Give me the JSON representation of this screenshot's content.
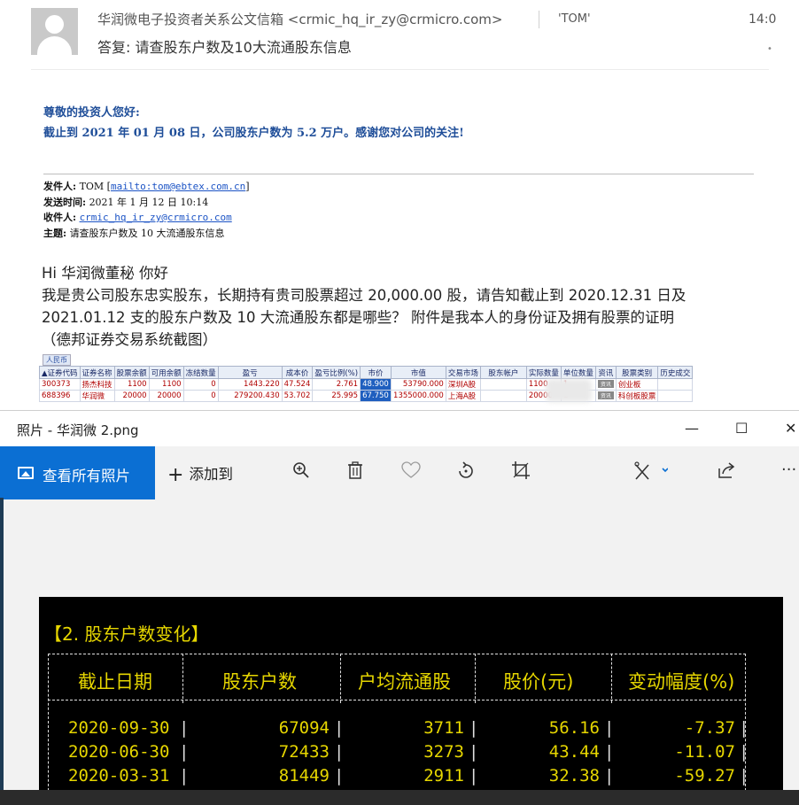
{
  "email": {
    "sender": "华润微电子投资者关系公文信箱 <crmic_hq_ir_zy@crmicro.com>",
    "recipient": "'TOM'",
    "time": "14:0",
    "subject": "答复: 请查股东户数及10大流通股东信息",
    "reply_line1": "尊敬的投资人您好:",
    "reply_line2": "截止到 2021 年 01 月 08 日，公司股东户数为 5.2 万户。感谢您对公司的关注!",
    "quote": {
      "from_label": "发件人:",
      "from_name": "TOM [",
      "from_link": "mailto:tom@ebtex.com.cn",
      "from_end": "]",
      "sent_label": "发送时间:",
      "sent_value": "2021 年 1 月 12 日 10:14",
      "to_label": "收件人:",
      "to_link": "crmic_hq_ir_zy@crmicro.com",
      "subject_label": "主题:",
      "subject_value": "请查股东户数及 10 大流通股东信息"
    },
    "body": {
      "line1": "Hi 华润微董秘 你好",
      "line2": "我是贵公司股东忠实股东，长期持有贵司股票超过 20,000.00 股，请告知截止到 2020.12.31 日及",
      "line3": "2021.01.12 支的股东户数及 10 大流通股东都是哪些？ 附件是我本人的身份证及拥有股票的证明",
      "line4": "（德邦证券交易系统截图）"
    }
  },
  "trade_table": {
    "currency_tab": "人民币",
    "headers": [
      "▲证券代码",
      "证券名称",
      "股票余额",
      "可用余额",
      "冻结数量",
      "盈亏",
      "成本价",
      "盈亏比例(%)",
      "市价",
      "市值",
      "交易市场",
      "股东帐户",
      "实际数量",
      "单位数量",
      "资讯",
      "股票类别",
      "历史成交"
    ],
    "rows": [
      [
        "300373",
        "扬杰科技",
        "1100",
        "1100",
        "0",
        "1443.220",
        "47.524",
        "2.761",
        "48.900",
        "53790.000",
        "深圳A股",
        "",
        "1100",
        "1",
        "资讯",
        "创业板",
        ""
      ],
      [
        "688396",
        "华润微",
        "20000",
        "20000",
        "0",
        "279200.430",
        "53.702",
        "25.995",
        "67.750",
        "1355000.000",
        "上海A股",
        "",
        "20000",
        "1",
        "资讯",
        "科创板股票",
        ""
      ]
    ]
  },
  "photos_app": {
    "window_title": "照片 - 华润微 2.png",
    "minimize": "—",
    "maximize": "☐",
    "close": "✕",
    "view_all": "查看所有照片",
    "add_to": "添加到",
    "more": "···"
  },
  "photo": {
    "section_title": "【2. 股东户数变化】",
    "headers": [
      "截止日期",
      "股东户数",
      "户均流通股",
      "股价(元)",
      "变动幅度(%)"
    ],
    "rows": [
      [
        "2020-09-30",
        "67094",
        "3711",
        "56.16",
        "-7.37"
      ],
      [
        "2020-06-30",
        "72433",
        "3273",
        "43.44",
        "-11.07"
      ],
      [
        "2020-03-31",
        "81449",
        "2911",
        "32.38",
        "-59.27"
      ]
    ]
  },
  "colors": {
    "accent_blue": "#0b6fd3",
    "reply_blue": "#1f4e99",
    "terminal_yellow": "#e6d600"
  }
}
